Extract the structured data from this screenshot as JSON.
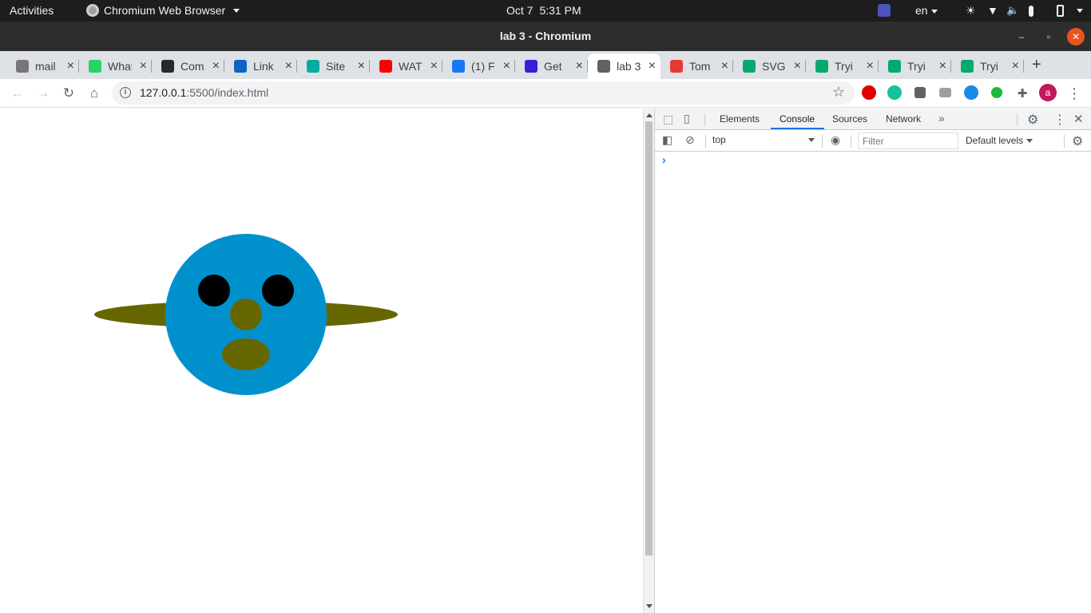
{
  "system_bar": {
    "activities": "Activities",
    "app_name": "Chromium Web Browser",
    "date": "Oct 7",
    "time": "5:31 PM",
    "language": "en"
  },
  "window": {
    "title": "lab 3 - Chromium"
  },
  "tabs": [
    {
      "label": "mail",
      "icon": "mail-icon",
      "color": "#777777"
    },
    {
      "label": "What",
      "icon": "whatsapp-icon",
      "color": "#25d366"
    },
    {
      "label": "Com",
      "icon": "github-icon",
      "color": "#24292e"
    },
    {
      "label": "Link",
      "icon": "linkedin-icon",
      "color": "#0a66c2"
    },
    {
      "label": "Site",
      "icon": "diamond-icon",
      "color": "#00ad9f"
    },
    {
      "label": "WAT",
      "icon": "youtube-icon",
      "color": "#ff0000"
    },
    {
      "label": "(1) F",
      "icon": "facebook-icon",
      "color": "#1877f2"
    },
    {
      "label": "Get",
      "icon": "planet-icon",
      "color": "#3b1ed8"
    },
    {
      "label": "lab 3",
      "icon": "globe-icon",
      "color": "#5f6368",
      "active": true
    },
    {
      "label": "Tom",
      "icon": "tomato-icon",
      "color": "#e53935"
    },
    {
      "label": "SVG",
      "icon": "w3schools-icon",
      "color": "#04aa6d"
    },
    {
      "label": "Tryi",
      "icon": "w3schools-icon",
      "color": "#04aa6d"
    },
    {
      "label": "Tryi",
      "icon": "w3schools-icon",
      "color": "#04aa6d"
    },
    {
      "label": "Tryi",
      "icon": "w3schools-icon",
      "color": "#04aa6d"
    }
  ],
  "address_bar": {
    "host": "127.0.0.1",
    "path": ":5500/index.html"
  },
  "profile": {
    "initial": "a",
    "color": "#c2185b"
  },
  "devtools": {
    "tabs": {
      "elements": "Elements",
      "console": "Console",
      "sources": "Sources",
      "network": "Network"
    },
    "context": "top",
    "filter_placeholder": "Filter",
    "levels": "Default levels",
    "prompt": "›"
  },
  "drawing": {
    "face_color": "#0091cd",
    "ears_color": "#666600",
    "eyes_color": "#000000",
    "nose_color": "#666600",
    "mouth_color": "#666600"
  }
}
